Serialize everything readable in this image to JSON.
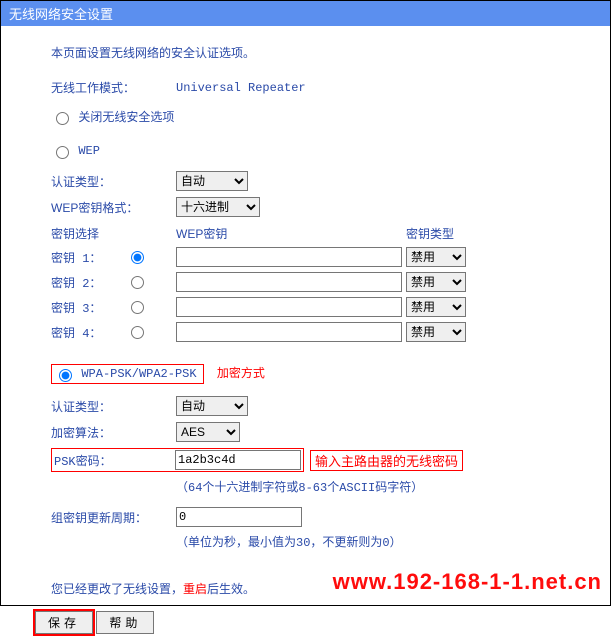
{
  "header": {
    "title": "无线网络安全设置"
  },
  "intro": "本页面设置无线网络的安全认证选项。",
  "wireless_mode": {
    "label": "无线工作模式：",
    "value": "Universal Repeater"
  },
  "radios": {
    "disable": "关闭无线安全选项",
    "wep": "WEP",
    "wpa": "WPA-PSK/WPA2-PSK"
  },
  "wep": {
    "auth_label": "认证类型：",
    "auth_value": "自动",
    "keyfmt_label": "WEP密钥格式：",
    "keyfmt_value": "十六进制",
    "cols": {
      "select": "密钥选择",
      "key": "WEP密钥",
      "type": "密钥类型"
    },
    "keys": [
      {
        "label": "密钥 1：",
        "value": "",
        "type": "禁用"
      },
      {
        "label": "密钥 2：",
        "value": "",
        "type": "禁用"
      },
      {
        "label": "密钥 3：",
        "value": "",
        "type": "禁用"
      },
      {
        "label": "密钥 4：",
        "value": "",
        "type": "禁用"
      }
    ]
  },
  "wpa": {
    "enc_label": "加密方式",
    "auth_label": "认证类型：",
    "auth_value": "自动",
    "algo_label": "加密算法：",
    "algo_value": "AES",
    "psk_label": "PSK密码：",
    "psk_value": "1a2b3c4d",
    "psk_annotation": "输入主路由器的无线密码",
    "psk_hint": "（64个十六进制字符或8-63个ASCII码字符）",
    "interval_label": "组密钥更新周期：",
    "interval_value": "0",
    "interval_hint": "（单位为秒，最小值为30，不更新则为0）"
  },
  "notice": {
    "pre": "您已经更改了无线设置，",
    "red": "重启",
    "post": "后生效。"
  },
  "buttons": {
    "save": "保存",
    "help": "帮助"
  },
  "watermark": "www.192-168-1-1.net.cn"
}
